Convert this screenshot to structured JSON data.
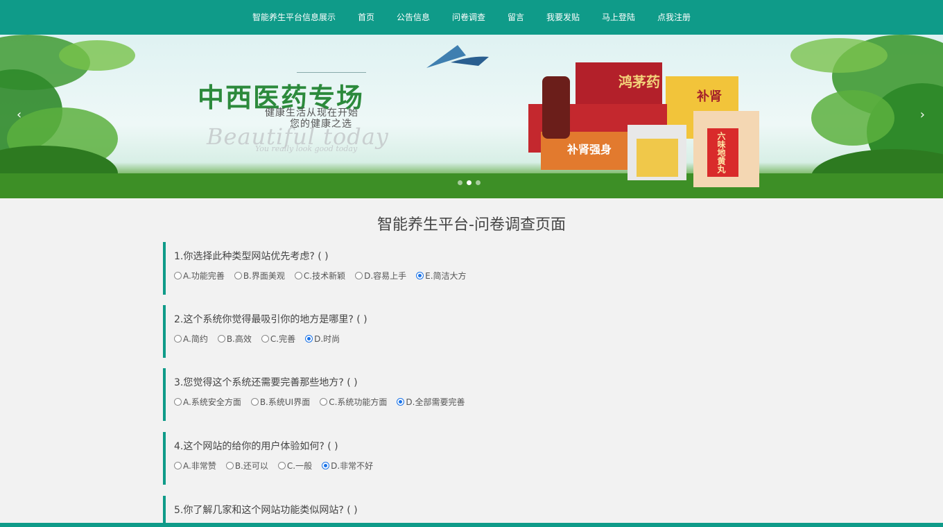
{
  "nav": {
    "items": [
      "智能养生平台信息展示",
      "首页",
      "公告信息",
      "问卷调查",
      "留言",
      "我要发贴",
      "马上登陆",
      "点我注册"
    ]
  },
  "banner": {
    "title": "中西医药专场",
    "subtitle1": "健康生活从现在开始",
    "subtitle2": "您的健康之选",
    "script1": "Beautiful today",
    "script2": "You really look good today",
    "box_labels": [
      "鸿茅药",
      "补肾",
      "补肾强身",
      "六味地黄丸"
    ],
    "prev_icon": "chevron-left-icon",
    "next_icon": "chevron-right-icon",
    "slide_count": 3,
    "active_slide": 1
  },
  "page": {
    "title": "智能养生平台-问卷调查页面"
  },
  "questions": [
    {
      "text": "1.你选择此种类型网站优先考虑?   ( )",
      "options": [
        "A.功能完善",
        "B.界面美观",
        "C.技术新颖",
        "D.容易上手",
        "E.简洁大方"
      ],
      "selected": 4
    },
    {
      "text": "2.这个系统你觉得最吸引你的地方是哪里?   ( )",
      "options": [
        "A.简约",
        "B.高效",
        "C.完善",
        "D.时尚"
      ],
      "selected": 3
    },
    {
      "text": "3.您觉得这个系统还需要完善那些地方?   ( )",
      "options": [
        "A.系统安全方面",
        "B.系统UI界面",
        "C.系统功能方面",
        "D.全部需要完善"
      ],
      "selected": 3
    },
    {
      "text": "4.这个网站的给你的用户体验如何?   ( )",
      "options": [
        "A.非常赞",
        "B.还可以",
        "C.一般",
        "D.非常不好"
      ],
      "selected": 3
    },
    {
      "text": "5.你了解几家和这个网站功能类似网站?   ( )",
      "options": [],
      "selected": -1
    }
  ],
  "colors": {
    "accent": "#0f9b89",
    "radio_checked": "#1a73e8"
  }
}
